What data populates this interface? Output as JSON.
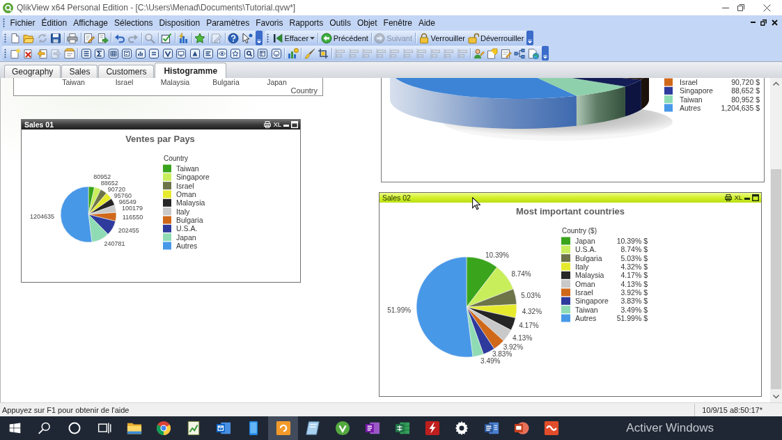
{
  "window": {
    "title": "QlikView x64 Personal Edition - [C:\\Users\\Menad\\Documents\\Tutorial.qvw*]"
  },
  "menu": [
    "Fichier",
    "Édition",
    "Affichage",
    "Sélections",
    "Disposition",
    "Paramètres",
    "Favoris",
    "Rapports",
    "Outils",
    "Objet",
    "Fenêtre",
    "Aide"
  ],
  "toolbars": [
    {
      "buttons": [
        {
          "disabled": false
        },
        {
          "disabled": false
        },
        {
          "disabled": true
        },
        {
          "disabled": false
        },
        {
          "disabled": false
        },
        {
          "disabled": false
        },
        {
          "disabled": false
        },
        {
          "disabled": false
        },
        {
          "disabled": true
        },
        {
          "disabled": true
        },
        {
          "disabled": false
        },
        {
          "disabled": false
        },
        {
          "disabled": false
        },
        {
          "disabled": true
        },
        {
          "disabled": false
        },
        {
          "disabled": false
        }
      ]
    },
    {
      "buttons": [
        {
          "label": "Effacer",
          "disabled": false,
          "dropdown": true
        },
        {
          "label": "Précédent",
          "disabled": false
        },
        {
          "label": "Suivant",
          "disabled": true
        },
        {
          "label": "Verrouiller",
          "disabled": false
        },
        {
          "label": "Déverrouiller",
          "disabled": false
        }
      ]
    },
    {
      "buttons": [
        {
          "disabled": false
        },
        {
          "disabled": false
        },
        {
          "disabled": false
        },
        {
          "disabled": true
        },
        {
          "disabled": false
        },
        {
          "disabled": false
        },
        {
          "disabled": false
        },
        {
          "disabled": false
        },
        {
          "disabled": false
        },
        {
          "disabled": false
        },
        {
          "disabled": false
        },
        {
          "disabled": false
        },
        {
          "disabled": false
        },
        {
          "disabled": false
        },
        {
          "disabled": false
        },
        {
          "disabled": false
        },
        {
          "disabled": false
        },
        {
          "disabled": false
        },
        {
          "disabled": false
        },
        {
          "disabled": false
        },
        {
          "disabled": false
        },
        {
          "disabled": false
        },
        {
          "disabled": false
        },
        {
          "disabled": true
        },
        {
          "disabled": true
        },
        {
          "disabled": true
        },
        {
          "disabled": true
        },
        {
          "disabled": true
        },
        {
          "disabled": true
        },
        {
          "disabled": true
        },
        {
          "disabled": true
        },
        {
          "disabled": true
        },
        {
          "disabled": true
        },
        {
          "disabled": false
        },
        {
          "disabled": false
        },
        {
          "disabled": false
        },
        {
          "disabled": false
        },
        {
          "disabled": false
        }
      ]
    }
  ],
  "tabs": [
    {
      "label": "Geography",
      "selected": false
    },
    {
      "label": "Sales",
      "selected": false
    },
    {
      "label": "Customers",
      "selected": false
    },
    {
      "label": "Histogramme",
      "selected": true
    }
  ],
  "sheet": {
    "axis_chart": {
      "axis_labels": [
        "Taiwan",
        "Israel",
        "Malaysia",
        "Bulgaria",
        "Japan"
      ],
      "axis_title": "Country"
    },
    "pie_3d": {
      "legend": [
        {
          "label": "Israel",
          "value": "90,720 $",
          "color": "#d0681a"
        },
        {
          "label": "Singapore",
          "value": "88,652 $",
          "color": "#2e3a9c"
        },
        {
          "label": "Taiwan",
          "value": "80,952 $",
          "color": "#8fdcb4"
        },
        {
          "label": "Autres",
          "value": "1,204,635 $",
          "color": "#4898e8"
        }
      ]
    },
    "objects": [
      {
        "caption": "Sales 01",
        "active": false,
        "xl_button": "XL",
        "chart_data": {
          "type": "pie",
          "title": "Ventes par Pays",
          "categories": [
            "Taiwan",
            "Singapore",
            "Israel",
            "Oman",
            "Malaysia",
            "Italy",
            "Bulgaria",
            "U.S.A.",
            "Japan",
            "Autres"
          ],
          "series": [
            {
              "values": [
                80952,
                88652,
                90720,
                95760,
                96549,
                100179,
                116550,
                202455,
                240781,
                1204635
              ]
            }
          ],
          "data_labels": true,
          "legend": {
            "title": "Country",
            "items": [
              {
                "color": "#3aa41c"
              },
              {
                "color": "#c8ee5c"
              },
              {
                "color": "#6c7448"
              },
              {
                "color": "#e6ea2c"
              },
              {
                "color": "#262626"
              },
              {
                "color": "#c9c9c9"
              },
              {
                "color": "#d0681a"
              },
              {
                "color": "#2e3a9c"
              },
              {
                "color": "#8fdcb4"
              },
              {
                "color": "#4898e8"
              }
            ]
          }
        }
      },
      {
        "caption": "Sales 02",
        "active": true,
        "xl_button": "XL",
        "chart_data": {
          "type": "pie",
          "title": "Most important countries",
          "categories": [
            "Japan",
            "U.S.A.",
            "Bulgaria",
            "Italy",
            "Malaysia",
            "Oman",
            "Israel",
            "Singapore",
            "Taiwan",
            "Autres"
          ],
          "series": [
            {
              "values": [
                10.39,
                8.74,
                5.03,
                4.32,
                4.17,
                4.13,
                3.92,
                3.83,
                3.49,
                51.99
              ]
            }
          ],
          "value_labels": [
            "10.39%",
            "8.74%",
            "5.03%",
            "4.32%",
            "4.17%",
            "4.13%",
            "3.92%",
            "3.83%",
            "3.49%",
            "51.99%"
          ],
          "legend": {
            "title": "Country ($)",
            "items": [
              {
                "value": "10.39% $",
                "color": "#3aa41c"
              },
              {
                "value": "8.74% $",
                "color": "#c8ee5c"
              },
              {
                "value": "5.03% $",
                "color": "#6c7448"
              },
              {
                "value": "4.32% $",
                "color": "#e6ea2c"
              },
              {
                "value": "4.17% $",
                "color": "#262626"
              },
              {
                "value": "4.13% $",
                "color": "#c9c9c9"
              },
              {
                "value": "3.92% $",
                "color": "#d0681a"
              },
              {
                "value": "3.83% $",
                "color": "#2e3a9c"
              },
              {
                "value": "3.49% $",
                "color": "#8fdcb4"
              },
              {
                "value": "51.99% $",
                "color": "#4898e8"
              }
            ]
          }
        }
      }
    ]
  },
  "status_bar": {
    "help": "Appuyez sur F1 pour obtenir de l'aide",
    "timestamp": "10/9/15 a8:50:17*"
  },
  "taskbar": {
    "apps": [
      {
        "selected": false
      },
      {
        "selected": false
      },
      {
        "selected": false
      },
      {
        "selected": false
      },
      {
        "selected": false
      },
      {
        "selected": true
      },
      {
        "selected": false
      },
      {
        "selected": false
      },
      {
        "selected": false
      },
      {
        "selected": false
      },
      {
        "selected": false
      },
      {
        "selected": false
      },
      {
        "selected": false
      },
      {
        "selected": false
      },
      {
        "selected": false
      }
    ],
    "notice": "Activer Windows"
  }
}
